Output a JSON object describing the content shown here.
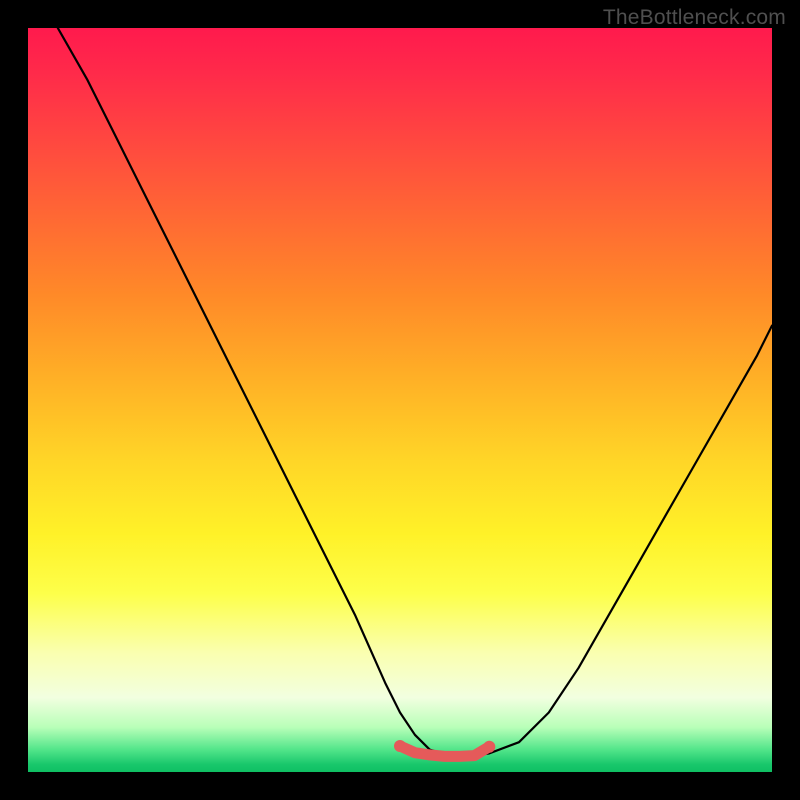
{
  "watermark": "TheBottleneck.com",
  "chart_data": {
    "type": "line",
    "title": "",
    "xlabel": "",
    "ylabel": "",
    "xlim": [
      0,
      100
    ],
    "ylim": [
      0,
      100
    ],
    "grid": false,
    "legend": false,
    "series": [
      {
        "name": "bottleneck-curve",
        "color": "#000000",
        "x": [
          4,
          8,
          12,
          16,
          20,
          24,
          28,
          32,
          36,
          40,
          44,
          48,
          50,
          52,
          54,
          56,
          58,
          60,
          62,
          66,
          70,
          74,
          78,
          82,
          86,
          90,
          94,
          98,
          100
        ],
        "values": [
          100,
          93,
          85,
          77,
          69,
          61,
          53,
          45,
          37,
          29,
          21,
          12,
          8,
          5,
          3,
          2.4,
          2.2,
          2.2,
          2.5,
          4,
          8,
          14,
          21,
          28,
          35,
          42,
          49,
          56,
          60
        ]
      },
      {
        "name": "optimal-band-marker",
        "color": "#e55a5a",
        "x": [
          50,
          52,
          54,
          56,
          58,
          60,
          62
        ],
        "values": [
          3.5,
          2.6,
          2.3,
          2.1,
          2.1,
          2.2,
          3.4
        ]
      }
    ],
    "background_gradient_stops": [
      {
        "pos": 0.0,
        "color": "#ff1a4d"
      },
      {
        "pos": 0.16,
        "color": "#ff4a3f"
      },
      {
        "pos": 0.36,
        "color": "#ff8a28"
      },
      {
        "pos": 0.58,
        "color": "#ffd527"
      },
      {
        "pos": 0.76,
        "color": "#fdff4a"
      },
      {
        "pos": 0.9,
        "color": "#f2ffe0"
      },
      {
        "pos": 0.97,
        "color": "#52e58a"
      },
      {
        "pos": 1.0,
        "color": "#0fbf63"
      }
    ]
  }
}
